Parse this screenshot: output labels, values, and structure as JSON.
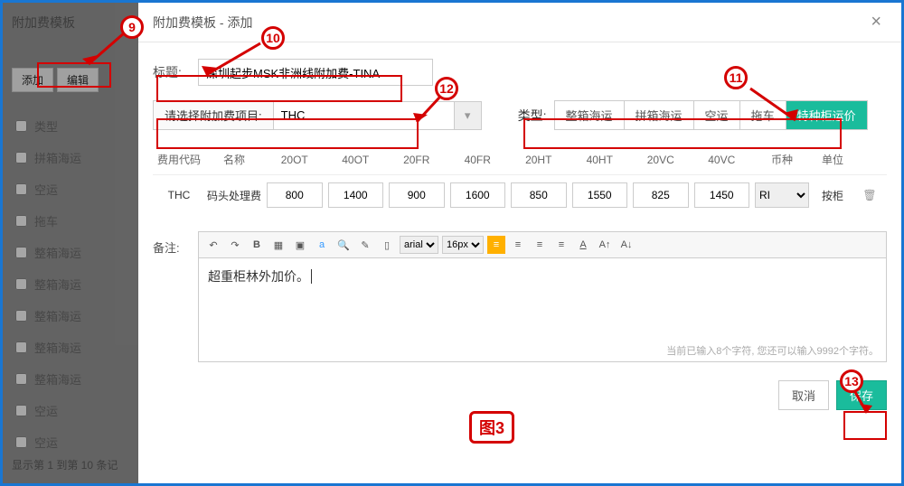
{
  "sidebar": {
    "title": "附加费模板",
    "add_btn": "添加",
    "edit_btn": "编辑",
    "items": [
      {
        "label": "类型"
      },
      {
        "label": "拼箱海运"
      },
      {
        "label": "空运"
      },
      {
        "label": "拖车"
      },
      {
        "label": "整箱海运"
      },
      {
        "label": "整箱海运"
      },
      {
        "label": "整箱海运"
      },
      {
        "label": "整箱海运"
      },
      {
        "label": "整箱海运"
      },
      {
        "label": "空运"
      },
      {
        "label": "空运"
      }
    ],
    "footer": "显示第 1 到第 10 条记"
  },
  "modal": {
    "title": "附加费模板 - 添加",
    "close": "×",
    "title_label": "标题:",
    "title_value": "深圳起步MSK非洲线附加费-TINA",
    "select_label": "请选择附加费项目:",
    "select_value": "THC",
    "type_label": "类型:",
    "type_options": [
      "整箱海运",
      "拼箱海运",
      "空运",
      "拖车",
      "特种柜运价"
    ],
    "type_active": 4,
    "columns": [
      "费用代码",
      "名称",
      "20OT",
      "40OT",
      "20FR",
      "40FR",
      "20HT",
      "40HT",
      "20VC",
      "40VC",
      "币种",
      "单位",
      ""
    ],
    "row": {
      "code": "THC",
      "name": "码头处理费",
      "v20OT": "800",
      "v40OT": "1400",
      "v20FR": "900",
      "v40FR": "1600",
      "v20HT": "850",
      "v40HT": "1550",
      "v20VC": "825",
      "v40VC": "1450",
      "currency": "RI",
      "unit": "按柜"
    },
    "remark_label": "备注:",
    "remark_text": "超重柜林外加价。",
    "toolbar": {
      "font_family": "arial",
      "font_size": "16px"
    },
    "char_hint_prefix": "当前已输入",
    "char_count": "8",
    "char_hint_mid": "个字符, 您还可以输入",
    "char_remain": "9992",
    "char_hint_suffix": "个字符。",
    "cancel": "取消",
    "save": "保存"
  },
  "annotations": {
    "c9": "9",
    "c10": "10",
    "c11": "11",
    "c12": "12",
    "c13": "13",
    "fig": "图3"
  }
}
